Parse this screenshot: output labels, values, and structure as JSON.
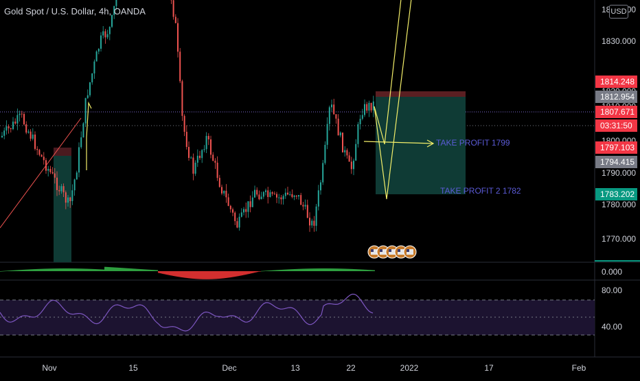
{
  "header": {
    "title": "Gold Spot / U.S. Dollar, 4h, OANDA",
    "currency": "USD"
  },
  "price_axis": {
    "ticks": [
      "1840.000",
      "1830.000",
      "1820.000",
      "1810.000",
      "1800.000",
      "1790.000",
      "1780.000",
      "1770.000"
    ],
    "labels": [
      {
        "text": "1814.248",
        "color": "#f23645"
      },
      {
        "text": "1812.954",
        "color": "#787b86"
      },
      {
        "text": "1807.671",
        "color": "#f23645"
      },
      {
        "text": "03:31:50",
        "color": "#f23645"
      },
      {
        "text": "1797.103",
        "color": "#f23645"
      },
      {
        "text": "1794.415",
        "color": "#787b86"
      },
      {
        "text": "1783.202",
        "color": "#089981"
      }
    ]
  },
  "macd_axis": {
    "zero": "0.000"
  },
  "rsi_axis": {
    "upper": "80.00",
    "lower": "40.00"
  },
  "time_axis": {
    "ticks": [
      "Nov",
      "15",
      "Dec",
      "13",
      "22",
      "2022",
      "17",
      "Feb"
    ]
  },
  "annotations": {
    "tp1": "TAKE PROFIT  1799",
    "tp2": "TAKE PROFIT 2   1782"
  },
  "colors": {
    "up": "#26a69a",
    "down": "#ef5350",
    "drawing": "#f5f06a",
    "rsi": "#7e57c2",
    "text_annotation": "#5b5bd6",
    "position_zone": "#0f3b35"
  },
  "events": [
    "flag-icon-us",
    "flag-icon-us",
    "flag-icon-us",
    "flag-icon-us",
    "flag-icon-us"
  ]
}
